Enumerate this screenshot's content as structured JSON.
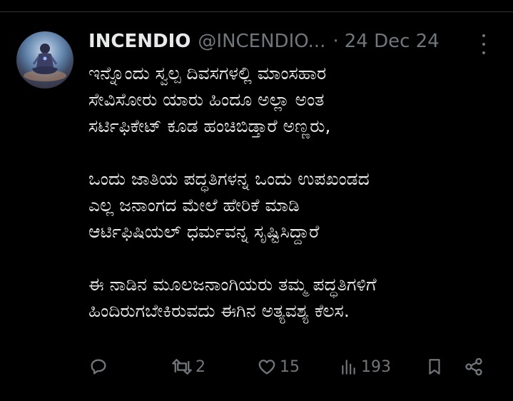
{
  "tweet": {
    "author": {
      "display_name": "INCENDIO",
      "handle": "@INCENDIO...",
      "avatar_icon": "meditating-figure-avatar"
    },
    "separator": "·",
    "date": "24 Dec 24",
    "text_lines": [
      "ಇನ್ನೊಂದು ಸ್ವಲ್ಪ ದಿವಸಗಳಲ್ಲಿ ಮಾಂಸಹಾರ",
      "ಸೇವಿಸೋರು ಯಾರು ಹಿಂದೂ ಅಲ್ಲಾ ಅಂತ",
      "ಸರ್ಟಿಫಿಕೇಟ್ ಕೂಡ ಹಂಚಿಬಿಡ್ತಾರೆ ಅಣ್ಣರು,",
      "",
      "ಒಂದು ಜಾತಿಯ ಪದ್ಧತಿಗಳನ್ನ ಒಂದು ಉಪಖಂಡದ",
      "ಎಲ್ಲ ಜನಾಂಗದ ಮೇಲೆ ಹೇರಿಕೆ ಮಾಡಿ",
      "ಆರ್ಟಿಫಿಷಿಯಲ್ ಧರ್ಮವನ್ನ ಸೃಷ್ಟಿಸಿದ್ದಾರೆ",
      "",
      "ಈ ನಾಡಿನ ಮೂಲಜನಾಂಗಿಯರು ತಮ್ಮ ಪದ್ಧತಿಗಳಿಗೆ",
      "ಹಿಂದಿರುಗಬೇಕಿರುವದು ಈಗಿನ ಅತ್ಯವಶ್ಯ ಕೆಲಸ."
    ],
    "actions": {
      "reply": {
        "icon": "reply-icon",
        "count": ""
      },
      "retweet": {
        "icon": "retweet-icon",
        "count": "2"
      },
      "like": {
        "icon": "heart-icon",
        "count": "15"
      },
      "views": {
        "icon": "views-icon",
        "count": "193"
      },
      "bookmark": {
        "icon": "bookmark-icon",
        "count": ""
      },
      "share": {
        "icon": "share-icon",
        "count": ""
      }
    }
  },
  "colors": {
    "background": "#000000",
    "text": "#e7e9ea",
    "secondary_text": "#71767b",
    "divider": "#2f3336"
  }
}
